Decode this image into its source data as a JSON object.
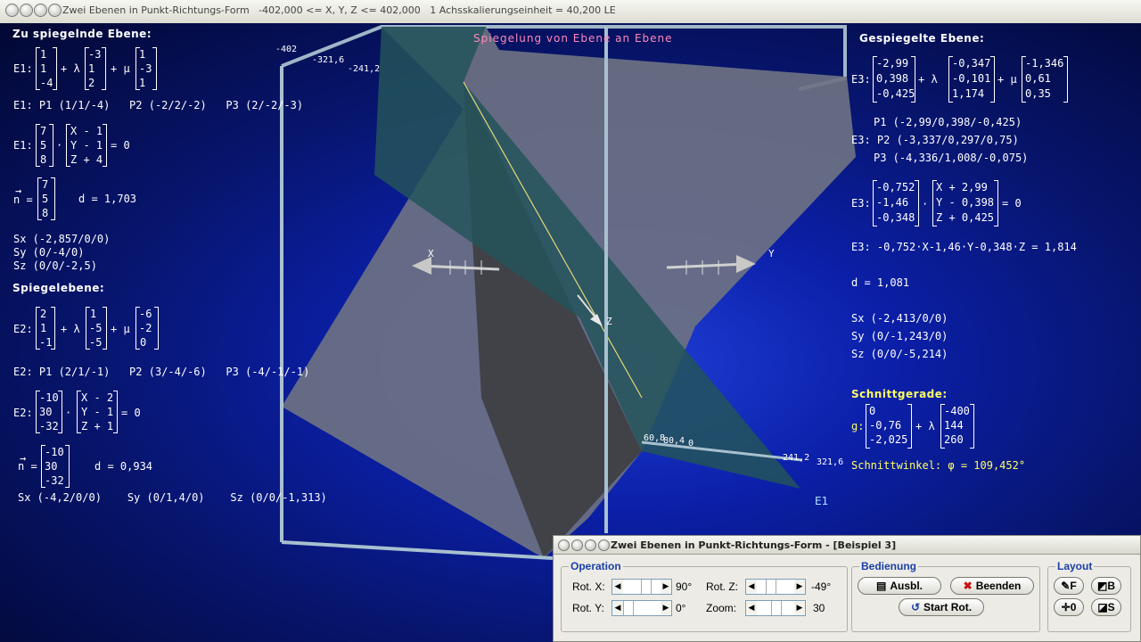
{
  "title_bar": {
    "title": "Zwei Ebenen in Punkt-Richtungs-Form   -402,000 <= X, Y, Z <= 402,000   1 Achsskalierungseinheit = 40,200 LE"
  },
  "scene": {
    "heading": "Spiegelung von Ebene an Ebene",
    "axis_labels": {
      "x": "X",
      "y": "Y",
      "z": "Z"
    },
    "tick_labels_top": [
      "-402",
      "-321,6",
      "-241,2"
    ],
    "tick_labels_bottom": [
      "60,8",
      "80,4",
      "0",
      "241,2",
      "321,6"
    ],
    "plane_label": "E1"
  },
  "left": {
    "heading1": "Zu spiegelnde Ebene:",
    "e1_label": "E1:",
    "e1_p": [
      "1",
      "1",
      "-4"
    ],
    "e1_u": [
      "-3",
      "1",
      "2"
    ],
    "e1_v": [
      "1",
      "-3",
      "1"
    ],
    "plus_lambda": "+ λ",
    "plus_mu": "+ μ",
    "e1_points": "E1: P1 (1/1/-4)   P2 (-2/2/-2)   P3 (2/-2/-3)",
    "e1_normal": [
      "7",
      "5",
      "8"
    ],
    "e1_diff": [
      "X - 1",
      "Y - 1",
      "Z + 4"
    ],
    "eq_zero": "= 0",
    "dot": "·",
    "n_label": "n =",
    "arrow": "→",
    "e1_n_vec": [
      "7",
      "5",
      "8"
    ],
    "e1_d": "d = 1,703",
    "e1_traces": [
      "Sx (-2,857/0/0)",
      "Sy (0/-4/0)",
      "Sz (0/0/-2,5)"
    ],
    "heading2": "Spiegelebene:",
    "e2_label": "E2:",
    "e2_p": [
      "2",
      "1",
      "-1"
    ],
    "e2_u": [
      "1",
      "-5",
      "-5"
    ],
    "e2_v": [
      "-6",
      "-2",
      "0"
    ],
    "e2_points": "E2: P1 (2/1/-1)   P2 (3/-4/-6)   P3 (-4/-1/-1)",
    "e2_normal": [
      "-10",
      "30",
      "-32"
    ],
    "e2_diff": [
      "X - 2",
      "Y - 1",
      "Z + 1"
    ],
    "e2_n_vec": [
      "-10",
      "30",
      "-32"
    ],
    "e2_d": "d = 0,934",
    "e2_traces": "Sx (-4,2/0/0)    Sy (0/1,4/0)    Sz (0/0/-1,313)"
  },
  "right": {
    "heading": "Gespiegelte Ebene:",
    "e3_label": "E3:",
    "e3_p": [
      "-2,99",
      "0,398",
      "-0,425"
    ],
    "e3_u": [
      "-0,347",
      "-0,101",
      "1,174"
    ],
    "e3_v": [
      "-1,346",
      "0,61",
      "0,35"
    ],
    "e3_points": [
      "P1 (-2,99/0,398/-0,425)",
      "E3: P2 (-3,337/0,297/0,75)",
      "P3 (-4,336/1,008/-0,075)"
    ],
    "e3_normal": [
      "-0,752",
      "-1,46",
      "-0,348"
    ],
    "e3_diff": [
      "X + 2,99",
      "Y - 0,398",
      "Z + 0,425"
    ],
    "e3_coord": "E3: -0,752·X-1,46·Y-0,348·Z = 1,814",
    "e3_d": "d = 1,081",
    "e3_traces": [
      "Sx (-2,413/0/0)",
      "Sy (0/-1,243/0)",
      "Sz (0/0/-5,214)"
    ],
    "heading_line": "Schnittgerade:",
    "g_label": "g:",
    "g_p": [
      "0",
      "-0,76",
      "-2,025"
    ],
    "g_v": [
      "-400",
      "144",
      "260"
    ],
    "angle": "Schnittwinkel: φ = 109,452°"
  },
  "panel": {
    "title": "Zwei Ebenen in Punkt-Richtungs-Form - [Beispiel 3]",
    "operation_label": "Operation",
    "rot_x_label": "Rot. X:",
    "rot_x_value": "90°",
    "rot_z_label": "Rot. Z:",
    "rot_z_value": "-49°",
    "rot_y_label": "Rot. Y:",
    "rot_y_value": "0°",
    "zoom_label": "Zoom:",
    "zoom_value": "30",
    "bedienung_label": "Bedienung",
    "ausbl_label": "Ausbl.",
    "beenden_label": "Beenden",
    "start_rot_label": "Start Rot.",
    "layout_label": "Layout",
    "layout_buttons": [
      "F",
      "B",
      "0",
      "S"
    ]
  }
}
